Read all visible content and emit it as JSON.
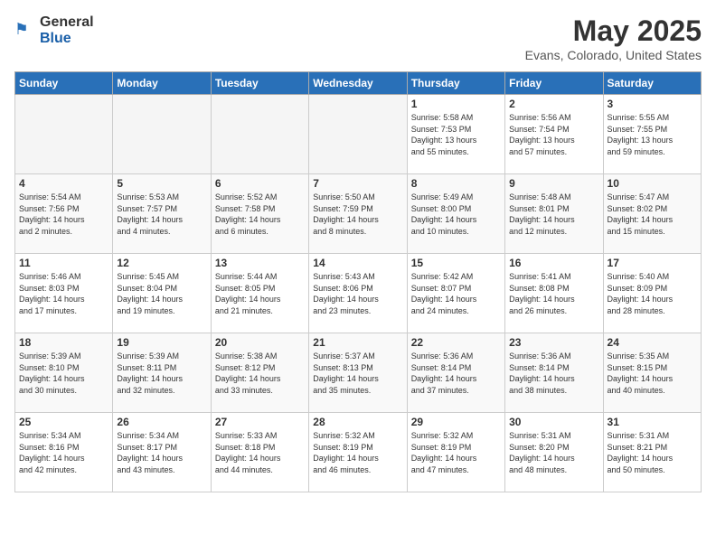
{
  "logo": {
    "general": "General",
    "blue": "Blue"
  },
  "title": "May 2025",
  "subtitle": "Evans, Colorado, United States",
  "days_of_week": [
    "Sunday",
    "Monday",
    "Tuesday",
    "Wednesday",
    "Thursday",
    "Friday",
    "Saturday"
  ],
  "weeks": [
    [
      {
        "day": "",
        "info": ""
      },
      {
        "day": "",
        "info": ""
      },
      {
        "day": "",
        "info": ""
      },
      {
        "day": "",
        "info": ""
      },
      {
        "day": "1",
        "info": "Sunrise: 5:58 AM\nSunset: 7:53 PM\nDaylight: 13 hours\nand 55 minutes."
      },
      {
        "day": "2",
        "info": "Sunrise: 5:56 AM\nSunset: 7:54 PM\nDaylight: 13 hours\nand 57 minutes."
      },
      {
        "day": "3",
        "info": "Sunrise: 5:55 AM\nSunset: 7:55 PM\nDaylight: 13 hours\nand 59 minutes."
      }
    ],
    [
      {
        "day": "4",
        "info": "Sunrise: 5:54 AM\nSunset: 7:56 PM\nDaylight: 14 hours\nand 2 minutes."
      },
      {
        "day": "5",
        "info": "Sunrise: 5:53 AM\nSunset: 7:57 PM\nDaylight: 14 hours\nand 4 minutes."
      },
      {
        "day": "6",
        "info": "Sunrise: 5:52 AM\nSunset: 7:58 PM\nDaylight: 14 hours\nand 6 minutes."
      },
      {
        "day": "7",
        "info": "Sunrise: 5:50 AM\nSunset: 7:59 PM\nDaylight: 14 hours\nand 8 minutes."
      },
      {
        "day": "8",
        "info": "Sunrise: 5:49 AM\nSunset: 8:00 PM\nDaylight: 14 hours\nand 10 minutes."
      },
      {
        "day": "9",
        "info": "Sunrise: 5:48 AM\nSunset: 8:01 PM\nDaylight: 14 hours\nand 12 minutes."
      },
      {
        "day": "10",
        "info": "Sunrise: 5:47 AM\nSunset: 8:02 PM\nDaylight: 14 hours\nand 15 minutes."
      }
    ],
    [
      {
        "day": "11",
        "info": "Sunrise: 5:46 AM\nSunset: 8:03 PM\nDaylight: 14 hours\nand 17 minutes."
      },
      {
        "day": "12",
        "info": "Sunrise: 5:45 AM\nSunset: 8:04 PM\nDaylight: 14 hours\nand 19 minutes."
      },
      {
        "day": "13",
        "info": "Sunrise: 5:44 AM\nSunset: 8:05 PM\nDaylight: 14 hours\nand 21 minutes."
      },
      {
        "day": "14",
        "info": "Sunrise: 5:43 AM\nSunset: 8:06 PM\nDaylight: 14 hours\nand 23 minutes."
      },
      {
        "day": "15",
        "info": "Sunrise: 5:42 AM\nSunset: 8:07 PM\nDaylight: 14 hours\nand 24 minutes."
      },
      {
        "day": "16",
        "info": "Sunrise: 5:41 AM\nSunset: 8:08 PM\nDaylight: 14 hours\nand 26 minutes."
      },
      {
        "day": "17",
        "info": "Sunrise: 5:40 AM\nSunset: 8:09 PM\nDaylight: 14 hours\nand 28 minutes."
      }
    ],
    [
      {
        "day": "18",
        "info": "Sunrise: 5:39 AM\nSunset: 8:10 PM\nDaylight: 14 hours\nand 30 minutes."
      },
      {
        "day": "19",
        "info": "Sunrise: 5:39 AM\nSunset: 8:11 PM\nDaylight: 14 hours\nand 32 minutes."
      },
      {
        "day": "20",
        "info": "Sunrise: 5:38 AM\nSunset: 8:12 PM\nDaylight: 14 hours\nand 33 minutes."
      },
      {
        "day": "21",
        "info": "Sunrise: 5:37 AM\nSunset: 8:13 PM\nDaylight: 14 hours\nand 35 minutes."
      },
      {
        "day": "22",
        "info": "Sunrise: 5:36 AM\nSunset: 8:14 PM\nDaylight: 14 hours\nand 37 minutes."
      },
      {
        "day": "23",
        "info": "Sunrise: 5:36 AM\nSunset: 8:14 PM\nDaylight: 14 hours\nand 38 minutes."
      },
      {
        "day": "24",
        "info": "Sunrise: 5:35 AM\nSunset: 8:15 PM\nDaylight: 14 hours\nand 40 minutes."
      }
    ],
    [
      {
        "day": "25",
        "info": "Sunrise: 5:34 AM\nSunset: 8:16 PM\nDaylight: 14 hours\nand 42 minutes."
      },
      {
        "day": "26",
        "info": "Sunrise: 5:34 AM\nSunset: 8:17 PM\nDaylight: 14 hours\nand 43 minutes."
      },
      {
        "day": "27",
        "info": "Sunrise: 5:33 AM\nSunset: 8:18 PM\nDaylight: 14 hours\nand 44 minutes."
      },
      {
        "day": "28",
        "info": "Sunrise: 5:32 AM\nSunset: 8:19 PM\nDaylight: 14 hours\nand 46 minutes."
      },
      {
        "day": "29",
        "info": "Sunrise: 5:32 AM\nSunset: 8:19 PM\nDaylight: 14 hours\nand 47 minutes."
      },
      {
        "day": "30",
        "info": "Sunrise: 5:31 AM\nSunset: 8:20 PM\nDaylight: 14 hours\nand 48 minutes."
      },
      {
        "day": "31",
        "info": "Sunrise: 5:31 AM\nSunset: 8:21 PM\nDaylight: 14 hours\nand 50 minutes."
      }
    ]
  ]
}
